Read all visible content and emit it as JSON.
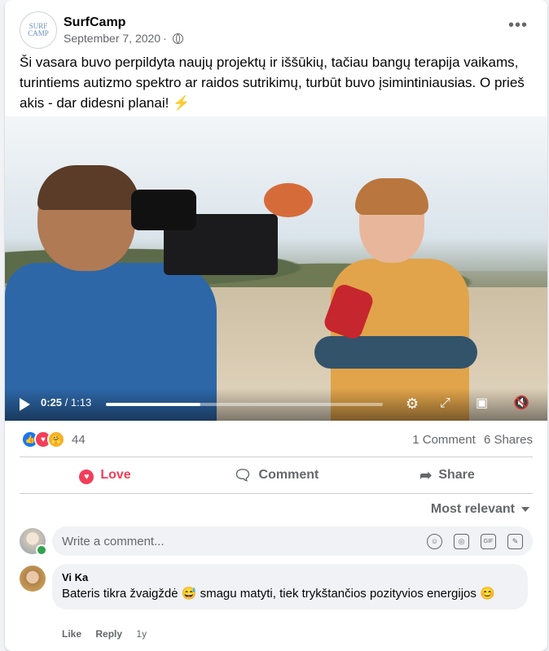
{
  "post": {
    "page_name": "SurfCamp",
    "logo_text_top": "SURF",
    "logo_text_bottom": "CAMP",
    "date": "September 7, 2020",
    "separator": "·",
    "more_label": "•••",
    "caption": "Ši vasara buvo perpildyta naujų projektų ir iššūkių, tačiau bangų terapija vaikams, turintiems autizmo spektro ar raidos sutrikimų, turbūt buvo įsimintiniausias. O prieš akis - dar didesni planai!",
    "caption_emoji": "⚡"
  },
  "video": {
    "current_time": "0:25",
    "time_sep": "/",
    "duration": "1:13",
    "progress": 0.342
  },
  "stats": {
    "reaction_count": "44",
    "comments": "1 Comment",
    "shares": "6 Shares",
    "reaction_types": [
      "like",
      "love",
      "care"
    ]
  },
  "actions": {
    "love_label": "Love",
    "comment_label": "Comment",
    "share_label": "Share"
  },
  "comments_section": {
    "sort_label": "Most relevant",
    "composer_placeholder": "Write a comment...",
    "composer_tools": [
      "emoji-icon",
      "camera-icon",
      "gif-icon",
      "sticker-icon"
    ]
  },
  "comment": {
    "author": "Vi Ka",
    "text": "Bateris tikra žvaigždė 😅 smagu matyti, tiek trykštančios pozityvios energijos 😊",
    "like_label": "Like",
    "reply_label": "Reply",
    "age": "1y"
  },
  "colors": {
    "love": "#f33e58",
    "like": "#1877f2",
    "muted": "#65676b"
  }
}
